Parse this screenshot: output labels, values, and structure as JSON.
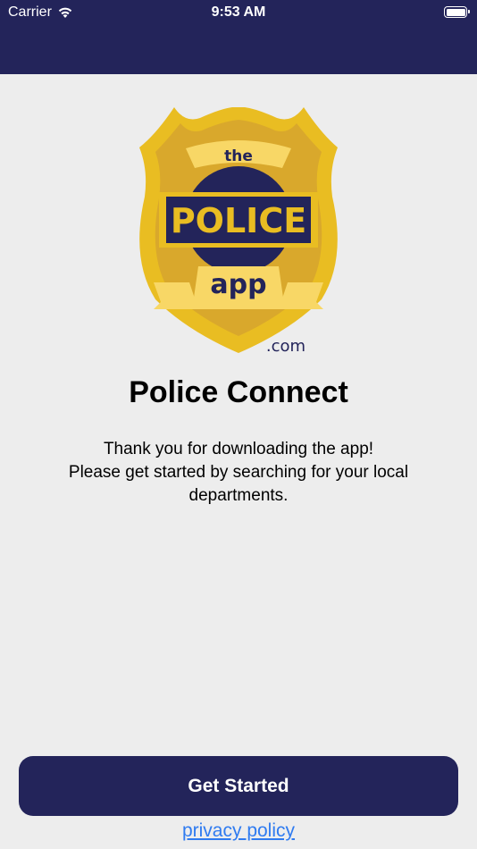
{
  "status_bar": {
    "carrier": "Carrier",
    "time": "9:53 AM"
  },
  "logo": {
    "word_top": "the",
    "word_main": "POLICE",
    "word_bottom": "app",
    "domain_suffix": ".com"
  },
  "welcome": {
    "title": "Police Connect",
    "message_lines": [
      "Thank you for downloading the app!",
      "Please get started by searching for your local",
      "departments."
    ]
  },
  "actions": {
    "get_started_label": "Get Started",
    "privacy_label": "privacy policy"
  },
  "colors": {
    "header": "#23245a",
    "background": "#ededed",
    "button": "#23245a",
    "link": "#2f7bf0",
    "badge_gold": "#e9bd22",
    "badge_inner": "#d9a82c",
    "banner": "#f8d766"
  }
}
